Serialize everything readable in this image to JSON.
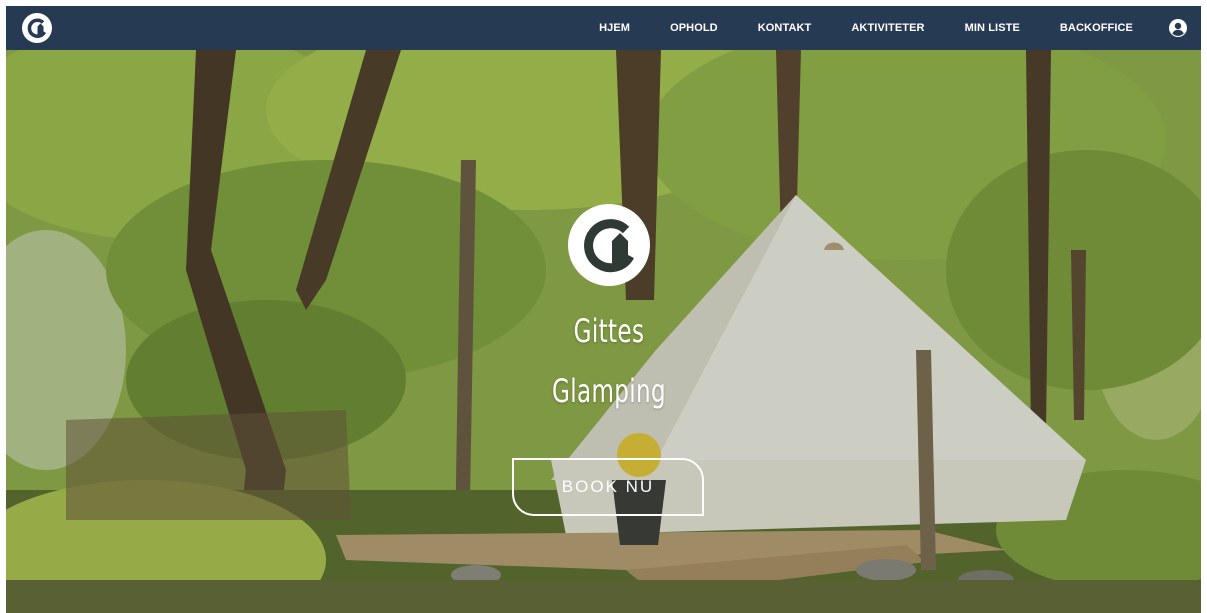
{
  "nav": {
    "logo_icon": "gittes-logo-icon",
    "items": [
      {
        "label": "HJEM"
      },
      {
        "label": "OPHOLD"
      },
      {
        "label": "KONTAKT"
      },
      {
        "label": "AKTIVITETER"
      },
      {
        "label": "MIN LISTE"
      },
      {
        "label": "BACKOFFICE"
      }
    ],
    "user_icon": "user-account-icon",
    "background_color": "#263b53"
  },
  "hero": {
    "logo_icon": "gittes-logo-icon",
    "title_line1": "Gittes",
    "title_line2": "Glamping",
    "book_button_label": "BOOK NU",
    "text_color": "#ffffff"
  }
}
